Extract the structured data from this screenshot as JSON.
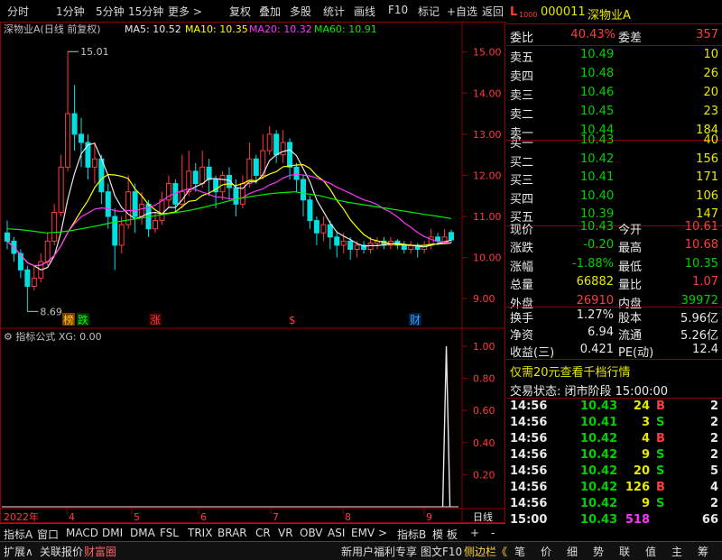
{
  "toolbar": {
    "left": [
      "分时",
      "1分钟",
      "5分钟",
      "15分钟",
      "更多 >"
    ],
    "right": [
      "复权",
      "叠加",
      "多股",
      "统计",
      "画线",
      "F10",
      "标记",
      "+自选",
      "返回"
    ]
  },
  "chart": {
    "title": "深物业A(日线 前复权)",
    "ma": [
      {
        "label": "MA5: 10.52",
        "color": "#e8e8e8"
      },
      {
        "label": "MA10: 10.35",
        "color": "#ffff00"
      },
      {
        "label": "MA20: 10.32",
        "color": "#ff33ff"
      },
      {
        "label": "MA60: 10.91",
        "color": "#00ee00"
      }
    ],
    "high_label": "15.01",
    "low_label": "8.69",
    "price_axis": [
      "15.00",
      "14.00",
      "13.00",
      "12.00",
      "11.00",
      "10.00",
      "9.00"
    ],
    "markers": [
      {
        "text": "榜",
        "color": "#ffcc00",
        "bg": "#804000"
      },
      {
        "text": "跌",
        "color": "#00ff00",
        "bg": "#003300"
      },
      {
        "text": "涨",
        "color": "#ff3b3b",
        "bg": "#330000"
      },
      {
        "text": "$",
        "color": "#ff3b3b",
        "bg": ""
      },
      {
        "text": "财",
        "color": "#40a0ff",
        "bg": "#002040"
      }
    ],
    "indicator_title": "指标公式 XG: 0.00",
    "indicator_axis": [
      "1.00",
      "0.80",
      "0.60",
      "0.40",
      "0.20"
    ],
    "date_axis": [
      "2022年",
      "4",
      "5",
      "6",
      "7",
      "8",
      "9"
    ],
    "period": "日线"
  },
  "bottom_tabs": [
    "指标A",
    "窗口",
    "MACD",
    "DMI",
    "DMA",
    "FSL",
    "TRIX",
    "BRAR",
    "CR",
    "VR",
    "OBV",
    "ASI",
    "EMV",
    ">",
    "指标B",
    "模 板",
    "+",
    "-"
  ],
  "footer": {
    "left": [
      "扩展∧",
      "关联报价",
      "财富圈"
    ],
    "middle": [
      "新用户福利专享",
      "图文F10",
      "侧边栏《"
    ],
    "right": [
      "笔",
      "价",
      "细",
      "势",
      "联",
      "值",
      "主",
      "筹"
    ]
  },
  "quote": {
    "code": "000011",
    "name": "深物业A",
    "weibi_label": "委比",
    "weibi": "40.43%",
    "weicha_label": "委差",
    "weicha": "357",
    "asks": [
      {
        "label": "卖五",
        "price": "10.49",
        "vol": "10"
      },
      {
        "label": "卖四",
        "price": "10.48",
        "vol": "26"
      },
      {
        "label": "卖三",
        "price": "10.46",
        "vol": "20"
      },
      {
        "label": "卖二",
        "price": "10.45",
        "vol": "23"
      },
      {
        "label": "卖一",
        "price": "10.44",
        "vol": "184"
      }
    ],
    "bids": [
      {
        "label": "买一",
        "price": "10.43",
        "vol": "40"
      },
      {
        "label": "买二",
        "price": "10.42",
        "vol": "156"
      },
      {
        "label": "买三",
        "price": "10.41",
        "vol": "171"
      },
      {
        "label": "买四",
        "price": "10.40",
        "vol": "106"
      },
      {
        "label": "买五",
        "price": "10.39",
        "vol": "147"
      }
    ],
    "stats": [
      {
        "l1": "现价",
        "v1": "10.43",
        "c1": "grn",
        "l2": "今开",
        "v2": "10.61",
        "c2": "red"
      },
      {
        "l1": "涨跌",
        "v1": "-0.20",
        "c1": "grn",
        "l2": "最高",
        "v2": "10.68",
        "c2": "red"
      },
      {
        "l1": "涨幅",
        "v1": "-1.88%",
        "c1": "grn",
        "l2": "最低",
        "v2": "10.35",
        "c2": "grn"
      },
      {
        "l1": "总量",
        "v1": "66882",
        "c1": "yel",
        "l2": "量比",
        "v2": "1.07",
        "c2": "red"
      },
      {
        "l1": "外盘",
        "v1": "26910",
        "c1": "red",
        "l2": "内盘",
        "v2": "39972",
        "c2": "grn"
      }
    ],
    "stats2": [
      {
        "l1": "换手",
        "v1": "1.27%",
        "l2": "股本",
        "v2": "5.96亿"
      },
      {
        "l1": "净资",
        "v1": "6.94",
        "l2": "流通",
        "v2": "5.26亿"
      },
      {
        "l1": "收益(三)",
        "v1": "0.421",
        "l2": "PE(动)",
        "v2": "12.4"
      }
    ],
    "promo": "仅需20元查看千档行情",
    "trade_status": "交易状态: 闭市阶段 15:00:00",
    "ticks": [
      {
        "t": "14:56",
        "p": "10.43",
        "v": "24",
        "s": "B",
        "n": "2"
      },
      {
        "t": "14:56",
        "p": "10.41",
        "v": "3",
        "s": "S",
        "n": "2"
      },
      {
        "t": "14:56",
        "p": "10.42",
        "v": "4",
        "s": "B",
        "n": "2"
      },
      {
        "t": "14:56",
        "p": "10.42",
        "v": "9",
        "s": "S",
        "n": "2"
      },
      {
        "t": "14:56",
        "p": "10.42",
        "v": "20",
        "s": "S",
        "n": "5"
      },
      {
        "t": "14:56",
        "p": "10.42",
        "v": "126",
        "s": "B",
        "n": "4"
      },
      {
        "t": "14:56",
        "p": "10.42",
        "v": "9",
        "s": "S",
        "n": "2"
      },
      {
        "t": "15:00",
        "p": "10.43",
        "v": "518",
        "s": "",
        "n": "66"
      }
    ]
  },
  "chart_data": {
    "type": "candlestick",
    "x_ticks": [
      "2022年",
      "4",
      "5",
      "6",
      "7",
      "8",
      "9"
    ],
    "ylim": [
      8.5,
      15.3
    ],
    "candles": [
      [
        10.6,
        10.4,
        10.9,
        10.2
      ],
      [
        10.4,
        10.1,
        10.5,
        9.9
      ],
      [
        10.1,
        9.7,
        10.2,
        9.5
      ],
      [
        9.7,
        9.3,
        9.8,
        8.69
      ],
      [
        9.3,
        9.5,
        9.8,
        9.2
      ],
      [
        9.5,
        9.9,
        10.1,
        9.4
      ],
      [
        9.9,
        10.4,
        10.6,
        9.8
      ],
      [
        10.4,
        11.1,
        11.3,
        10.3
      ],
      [
        11.1,
        12.2,
        12.5,
        11.0
      ],
      [
        12.2,
        13.5,
        15.01,
        12.1
      ],
      [
        13.5,
        13.0,
        14.2,
        12.6
      ],
      [
        13.0,
        12.8,
        13.4,
        12.2
      ],
      [
        12.8,
        12.2,
        13.0,
        11.9
      ],
      [
        12.2,
        12.4,
        12.8,
        11.8
      ],
      [
        12.4,
        11.6,
        12.5,
        11.3
      ],
      [
        11.6,
        11.0,
        11.8,
        10.7
      ],
      [
        11.0,
        10.3,
        11.2,
        9.7
      ],
      [
        10.3,
        10.8,
        11.0,
        10.1
      ],
      [
        10.8,
        11.6,
        12.0,
        10.7
      ],
      [
        11.6,
        11.0,
        11.8,
        10.6
      ],
      [
        11.0,
        11.3,
        11.6,
        10.8
      ],
      [
        11.3,
        10.7,
        11.4,
        10.5
      ],
      [
        10.7,
        10.9,
        11.1,
        10.6
      ],
      [
        10.9,
        11.4,
        11.6,
        10.8
      ],
      [
        11.4,
        11.8,
        12.0,
        11.2
      ],
      [
        11.8,
        11.3,
        11.9,
        11.1
      ],
      [
        11.3,
        11.6,
        12.5,
        11.2
      ],
      [
        11.6,
        12.1,
        12.6,
        11.5
      ],
      [
        12.1,
        11.8,
        12.3,
        11.6
      ],
      [
        11.8,
        12.2,
        12.6,
        11.7
      ],
      [
        12.2,
        11.9,
        12.4,
        11.5
      ],
      [
        11.9,
        11.6,
        12.0,
        11.2
      ],
      [
        11.6,
        12.0,
        12.1,
        11.4
      ],
      [
        12.0,
        11.7,
        12.2,
        11.4
      ],
      [
        11.7,
        11.3,
        11.9,
        11.0
      ],
      [
        11.3,
        11.8,
        12.0,
        11.2
      ],
      [
        11.8,
        12.4,
        12.8,
        11.7
      ],
      [
        12.4,
        12.0,
        12.5,
        11.8
      ],
      [
        12.0,
        12.6,
        13.0,
        11.9
      ],
      [
        12.6,
        13.0,
        13.2,
        12.5
      ],
      [
        13.0,
        12.5,
        13.1,
        12.3
      ],
      [
        12.5,
        12.8,
        13.1,
        12.3
      ],
      [
        12.8,
        12.2,
        12.9,
        11.9
      ],
      [
        12.2,
        11.9,
        12.3,
        11.6
      ],
      [
        11.9,
        11.4,
        12.0,
        11.0
      ],
      [
        11.4,
        10.9,
        11.5,
        10.7
      ],
      [
        10.9,
        10.6,
        11.0,
        10.3
      ],
      [
        10.6,
        10.8,
        11.0,
        10.4
      ],
      [
        10.8,
        10.5,
        10.9,
        10.2
      ],
      [
        10.5,
        10.3,
        10.6,
        10.0
      ],
      [
        10.3,
        10.4,
        10.6,
        10.1
      ],
      [
        10.4,
        10.2,
        10.5,
        9.95
      ],
      [
        10.2,
        10.3,
        10.4,
        10.0
      ],
      [
        10.3,
        10.2,
        10.4,
        10.1
      ],
      [
        10.2,
        10.35,
        10.5,
        10.1
      ],
      [
        10.35,
        10.4,
        10.5,
        10.2
      ],
      [
        10.4,
        10.3,
        10.5,
        10.2
      ],
      [
        10.3,
        10.4,
        10.5,
        10.2
      ],
      [
        10.4,
        10.3,
        10.45,
        10.2
      ],
      [
        10.3,
        10.2,
        10.4,
        10.1
      ],
      [
        10.2,
        10.3,
        10.4,
        10.1
      ],
      [
        10.3,
        10.2,
        10.35,
        10.0
      ],
      [
        10.2,
        10.3,
        10.4,
        10.1
      ],
      [
        10.3,
        10.5,
        10.7,
        10.2
      ],
      [
        10.5,
        10.4,
        10.6,
        10.3
      ],
      [
        10.4,
        10.5,
        10.7,
        10.35
      ],
      [
        10.61,
        10.43,
        10.68,
        10.35
      ]
    ],
    "ma60": [
      10.7,
      10.68,
      10.64,
      10.6,
      10.62,
      10.66,
      10.72,
      10.78,
      10.85,
      10.9,
      10.95,
      11.0,
      11.05,
      11.1,
      11.15,
      11.22,
      11.3,
      11.38,
      11.45,
      11.5,
      11.55,
      11.58,
      11.6,
      11.55,
      11.5,
      11.42,
      11.35,
      11.3,
      11.25,
      11.2,
      11.15,
      11.1,
      11.05,
      11.0,
      10.95
    ],
    "xg_spike_index": 65,
    "xg_spike_value": 1.0
  }
}
